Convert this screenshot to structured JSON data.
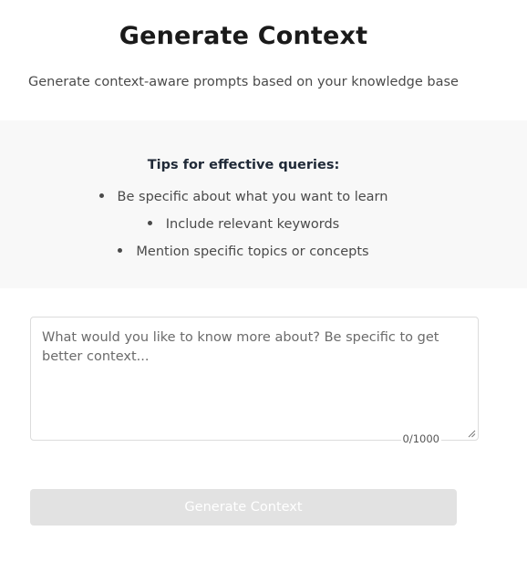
{
  "header": {
    "title": "Generate Context",
    "subtitle": "Generate context-aware prompts based on your knowledge base"
  },
  "tips": {
    "heading": "Tips for effective queries:",
    "items": [
      "Be specific about what you want to learn",
      "Include relevant keywords",
      "Mention specific topics or concepts"
    ]
  },
  "query": {
    "value": "",
    "placeholder": "What would you like to know more about? Be specific to get better context...",
    "counter": "0/1000"
  },
  "actions": {
    "generate_label": "Generate Context"
  },
  "colors": {
    "tips_background": "#f8f8f8",
    "button_disabled_background": "#e2e2e2",
    "button_disabled_text": "#ffffff"
  }
}
